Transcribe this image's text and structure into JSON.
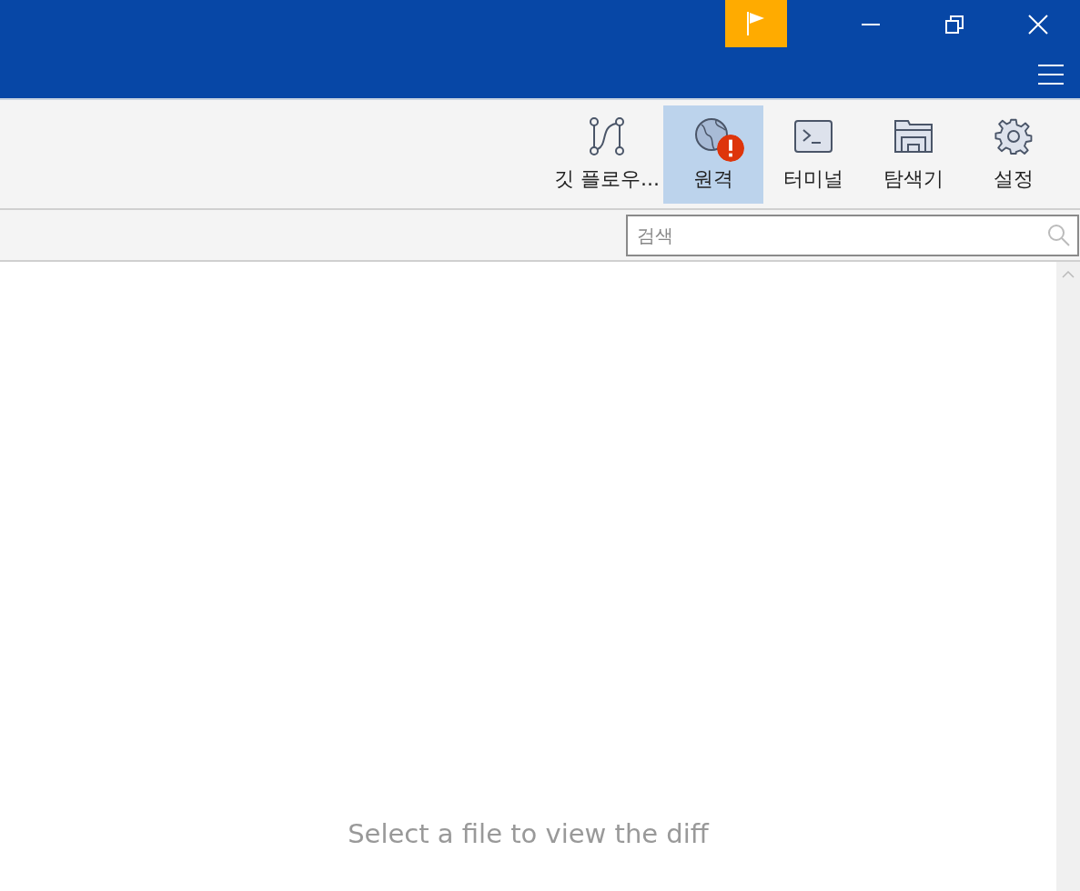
{
  "toolbar": {
    "items": [
      {
        "kind": "gitflow",
        "label": "깃 플로우...",
        "selected": false,
        "warning": false
      },
      {
        "kind": "remote",
        "label": "원격",
        "selected": true,
        "warning": true
      },
      {
        "kind": "terminal",
        "label": "터미널",
        "selected": false,
        "warning": false
      },
      {
        "kind": "explorer",
        "label": "탐색기",
        "selected": false,
        "warning": false
      },
      {
        "kind": "settings",
        "label": "설정",
        "selected": false,
        "warning": false
      }
    ]
  },
  "search": {
    "placeholder": "검색"
  },
  "diff_view": {
    "message": "Select a file to view the diff"
  }
}
